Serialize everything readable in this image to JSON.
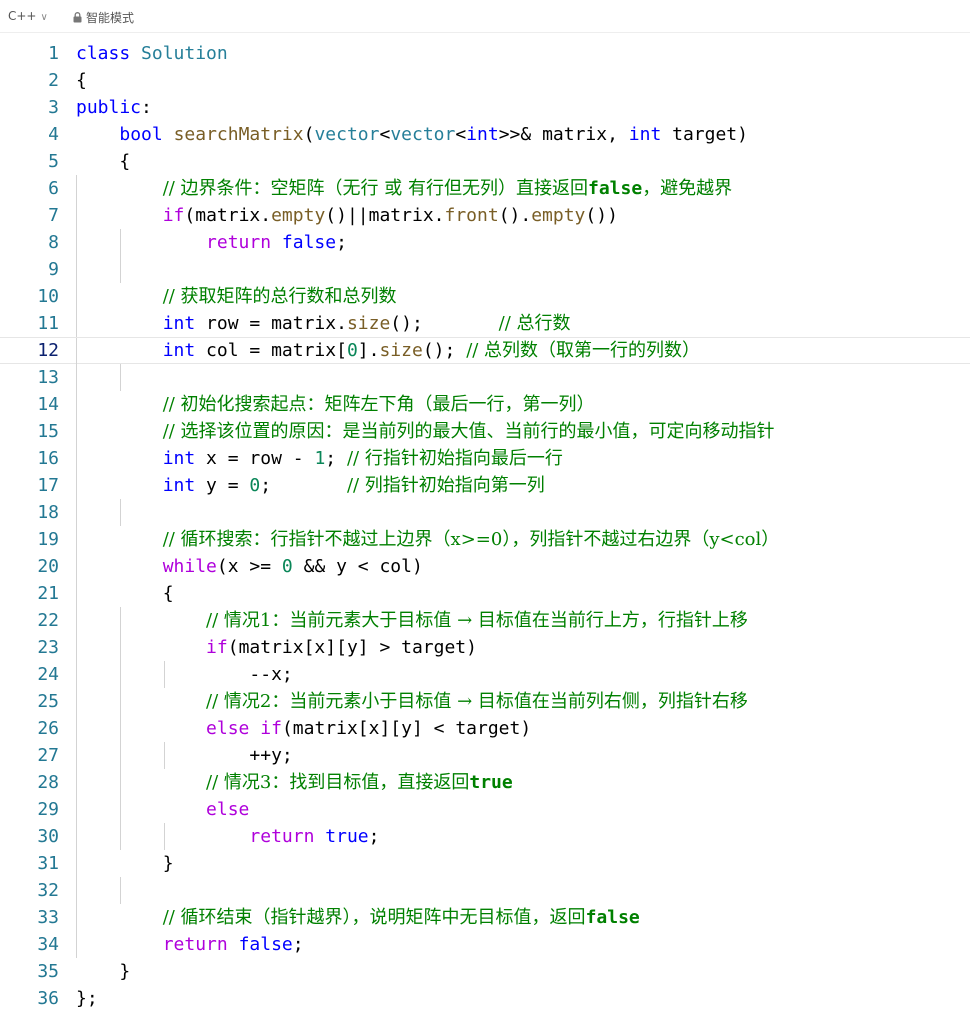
{
  "toolbar": {
    "language": "C++",
    "mode": "智能模式"
  },
  "editor": {
    "active_line": 12,
    "lines": [
      "class Solution",
      "{",
      "public:",
      "    bool searchMatrix(vector<vector<int>>& matrix, int target)",
      "    {",
      "        // 边界条件：空矩阵（无行 或 有行但无列）直接返回false，避免越界",
      "        if(matrix.empty()||matrix.front().empty())",
      "            return false;",
      "",
      "        // 获取矩阵的总行数和总列数",
      "        int row = matrix.size();       // 总行数",
      "        int col = matrix[0].size(); // 总列数（取第一行的列数）",
      "",
      "        // 初始化搜索起点：矩阵左下角（最后一行，第一列）",
      "        // 选择该位置的原因：是当前列的最大值、当前行的最小值，可定向移动指针",
      "        int x = row - 1; // 行指针初始指向最后一行",
      "        int y = 0;       // 列指针初始指向第一列",
      "",
      "        // 循环搜索：行指针不越过上边界（x>=0），列指针不越过右边界（y<col）",
      "        while(x >= 0 && y < col)",
      "        {",
      "            // 情况1：当前元素大于目标值 → 目标值在当前行上方，行指针上移",
      "            if(matrix[x][y] > target)",
      "                --x;",
      "            // 情况2：当前元素小于目标值 → 目标值在当前列右侧，列指针右移",
      "            else if(matrix[x][y] < target)",
      "                ++y;",
      "            // 情况3：找到目标值，直接返回true",
      "            else",
      "                return true;",
      "        }",
      "",
      "        // 循环结束（指针越界），说明矩阵中无目标值，返回false",
      "        return false;",
      "    }",
      "};"
    ]
  }
}
